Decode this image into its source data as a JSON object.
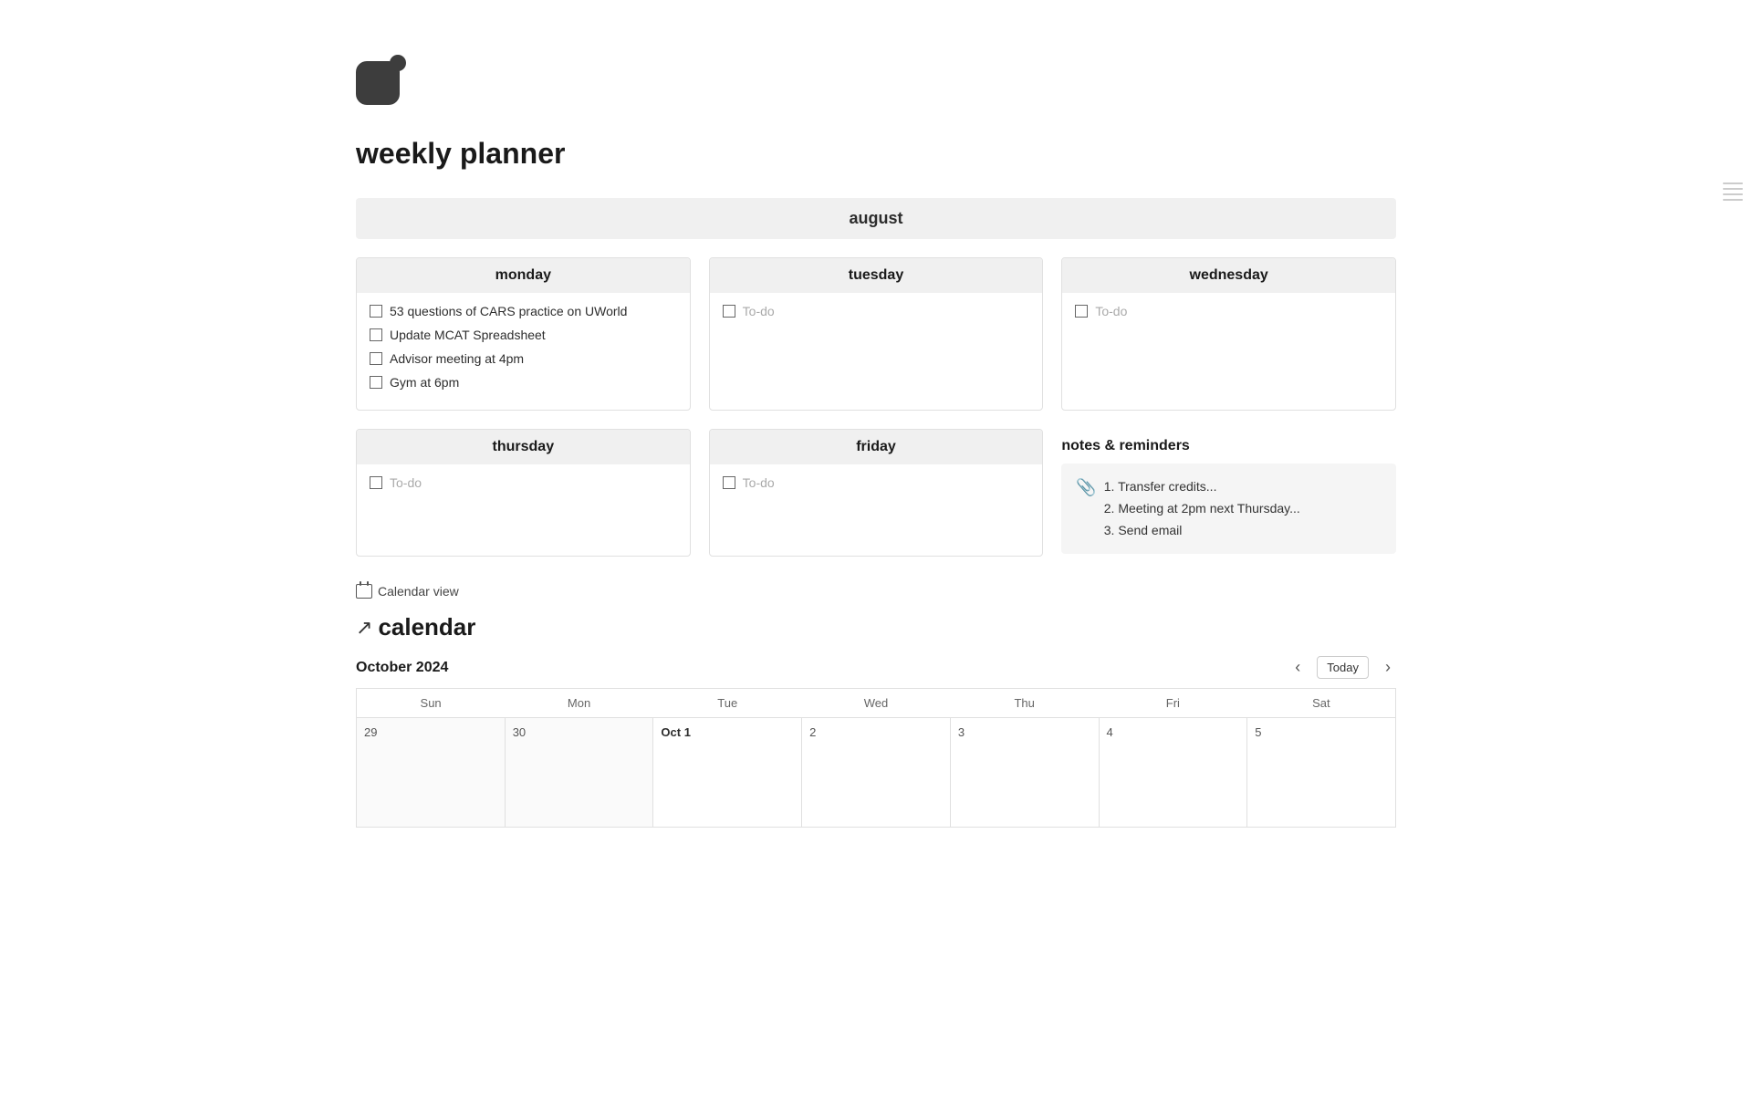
{
  "app": {
    "title": "weekly planner"
  },
  "planner": {
    "month": "august",
    "days": [
      {
        "name": "monday",
        "tasks": [
          {
            "label": "53 questions of CARS practice on UWorld",
            "placeholder": false
          },
          {
            "label": "Update MCAT Spreadsheet",
            "placeholder": false
          },
          {
            "label": "Advisor meeting at 4pm",
            "placeholder": false
          },
          {
            "label": "Gym at 6pm",
            "placeholder": false
          }
        ]
      },
      {
        "name": "tuesday",
        "tasks": [
          {
            "label": "To-do",
            "placeholder": true
          }
        ]
      },
      {
        "name": "wednesday",
        "tasks": [
          {
            "label": "To-do",
            "placeholder": true
          }
        ]
      },
      {
        "name": "thursday",
        "tasks": [
          {
            "label": "To-do",
            "placeholder": true
          }
        ]
      },
      {
        "name": "friday",
        "tasks": [
          {
            "label": "To-do",
            "placeholder": true
          }
        ]
      }
    ],
    "notes": {
      "header": "notes & reminders",
      "items": [
        "1. Transfer credits...",
        "2. Meeting at 2pm next Thursday...",
        "3. Send email"
      ]
    },
    "calendar_view_label": "Calendar view"
  },
  "calendar": {
    "title": "calendar",
    "month_label": "October 2024",
    "nav": {
      "prev": "‹",
      "today": "Today",
      "next": "›"
    },
    "weekdays": [
      "Sun",
      "Mon",
      "Tue",
      "Wed",
      "Thu",
      "Fri",
      "Sat"
    ],
    "weeks": [
      [
        {
          "date": "29",
          "other": true,
          "label": ""
        },
        {
          "date": "30",
          "other": true,
          "label": ""
        },
        {
          "date": "1",
          "other": false,
          "label": "Oct 1"
        },
        {
          "date": "2",
          "other": false,
          "label": ""
        },
        {
          "date": "3",
          "other": false,
          "label": ""
        },
        {
          "date": "4",
          "other": false,
          "label": ""
        },
        {
          "date": "5",
          "other": false,
          "label": ""
        }
      ]
    ]
  }
}
